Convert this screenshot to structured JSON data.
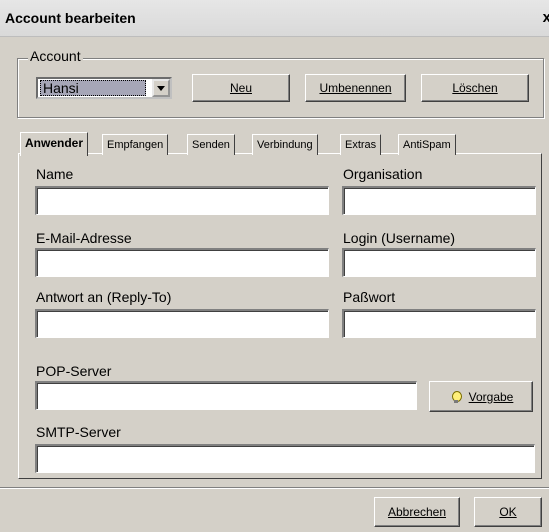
{
  "window": {
    "title": "Account bearbeiten",
    "close_glyph": "x"
  },
  "account": {
    "group_label": "Account",
    "selected": "Hansi",
    "buttons": {
      "new": "Neu",
      "rename": "Umbenennen",
      "delete": "Löschen"
    }
  },
  "tabs": [
    "Anwender",
    "Empfangen",
    "Senden",
    "Verbindung",
    "Extras",
    "AntiSpam"
  ],
  "form": {
    "name_label": "Name",
    "org_label": "Organisation",
    "email_label": "E-Mail-Adresse",
    "login_label": "Login (Username)",
    "reply_label": "Antwort an (Reply-To)",
    "password_label": "Paßwort",
    "pop_label": "POP-Server",
    "smtp_label": "SMTP-Server",
    "default_button": "Vorgabe"
  },
  "footer": {
    "cancel": "Abbrechen",
    "ok": "OK"
  },
  "icons": {
    "close": "close-icon",
    "combo": "chevron-down-icon",
    "default": "lightbulb-icon"
  }
}
